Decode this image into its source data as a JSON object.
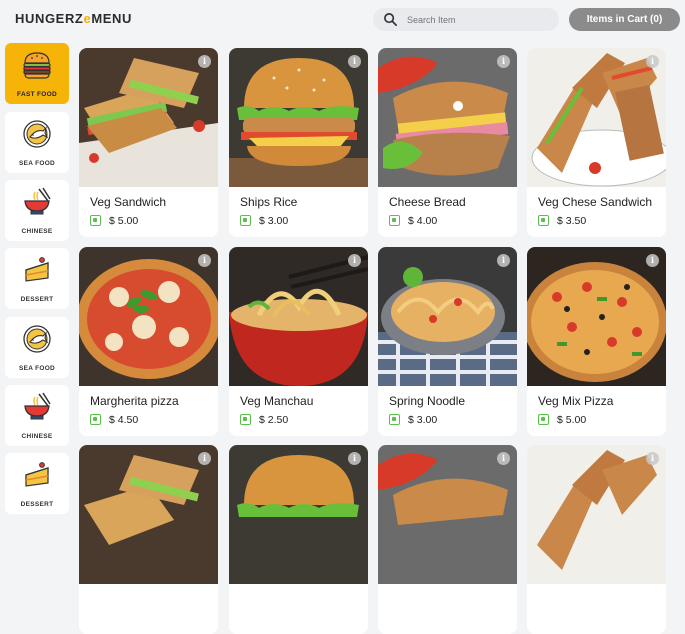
{
  "header": {
    "logo_main": "HUNGERZ",
    "logo_e": "e",
    "logo_menu": "MENU",
    "search_placeholder": "Search Item",
    "cart_label": "Items in Cart (0)"
  },
  "sidebar": {
    "items": [
      {
        "label": "FAST FOOD",
        "icon": "burger-icon",
        "active": true
      },
      {
        "label": "SEA FOOD",
        "icon": "fish-plate-icon",
        "active": false
      },
      {
        "label": "CHINESE",
        "icon": "noodle-bowl-icon",
        "active": false
      },
      {
        "label": "DESSERT",
        "icon": "cake-slice-icon",
        "active": false
      },
      {
        "label": "SEA FOOD",
        "icon": "fish-plate-icon",
        "active": false
      },
      {
        "label": "CHINESE",
        "icon": "noodle-bowl-icon",
        "active": false
      },
      {
        "label": "DESSERT",
        "icon": "cake-slice-icon",
        "active": false
      }
    ]
  },
  "items": [
    {
      "name": "Veg Sandwich",
      "price": "$ 5.00",
      "photo": "sandwich"
    },
    {
      "name": "Ships Rice",
      "price": "$ 3.00",
      "photo": "burger"
    },
    {
      "name": "Cheese Bread",
      "price": "$ 4.00",
      "photo": "sub"
    },
    {
      "name": "Veg  Chese Sandwich",
      "price": "$ 3.50",
      "photo": "grilled-sandwich"
    },
    {
      "name": "Margherita pizza",
      "price": "$ 4.50",
      "photo": "pizza-margherita"
    },
    {
      "name": "Veg Manchau",
      "price": "$ 2.50",
      "photo": "noodle-soup"
    },
    {
      "name": "Spring Noodle",
      "price": "$ 3.00",
      "photo": "noodles"
    },
    {
      "name": "Veg Mix Pizza",
      "price": "$ 5.00",
      "photo": "pizza-mix"
    },
    {
      "name": "",
      "price": "",
      "photo": "sandwich"
    },
    {
      "name": "",
      "price": "",
      "photo": "burger"
    },
    {
      "name": "",
      "price": "",
      "photo": "sub"
    },
    {
      "name": "",
      "price": "",
      "photo": "grilled-sandwich"
    }
  ],
  "colors": {
    "accent": "#f6b409",
    "veg": "#5bbf4b",
    "cart_button": "#8b8b8b",
    "background": "#f3f4f6"
  }
}
